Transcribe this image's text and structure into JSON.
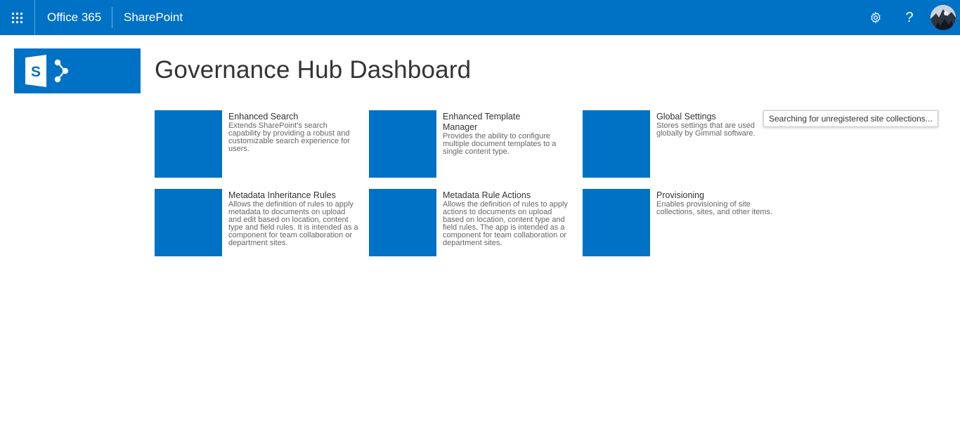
{
  "suitebar": {
    "brand": "Office 365",
    "app_name": "SharePoint",
    "help_label": "?",
    "icons": {
      "launcher": "app-launcher-icon",
      "settings": "gear-icon",
      "help": "help-icon",
      "avatar": "user-avatar"
    },
    "accent": "#0072c6"
  },
  "header": {
    "logo_letter": "S",
    "title": "Governance Hub Dashboard"
  },
  "tiles": [
    {
      "title": "Enhanced Search",
      "description": "Extends SharePoint's search capability by providing a robust and customizable search experience for users."
    },
    {
      "title": "Enhanced Template Manager",
      "description": "Provides the ability to configure multiple document templates to a single content type."
    },
    {
      "title": "Global Settings",
      "description": "Stores settings that are used globally by Gimmal software."
    },
    {
      "title": "Metadata Inheritance Rules",
      "description": "Allows the definition of rules to apply metadata to documents on upload and edit based on location, content type and field rules. It is intended as a component for team collaboration or department sites."
    },
    {
      "title": "Metadata Rule Actions",
      "description": "Allows the definition of rules to apply actions to documents on upload based on location, content type and field rules. The app is intended as a component for team collaboration or department sites."
    },
    {
      "title": "Provisioning",
      "description": "Enables provisioning of site collections, sites, and other items."
    }
  ],
  "status": {
    "message": "Searching for unregistered site collections..."
  }
}
